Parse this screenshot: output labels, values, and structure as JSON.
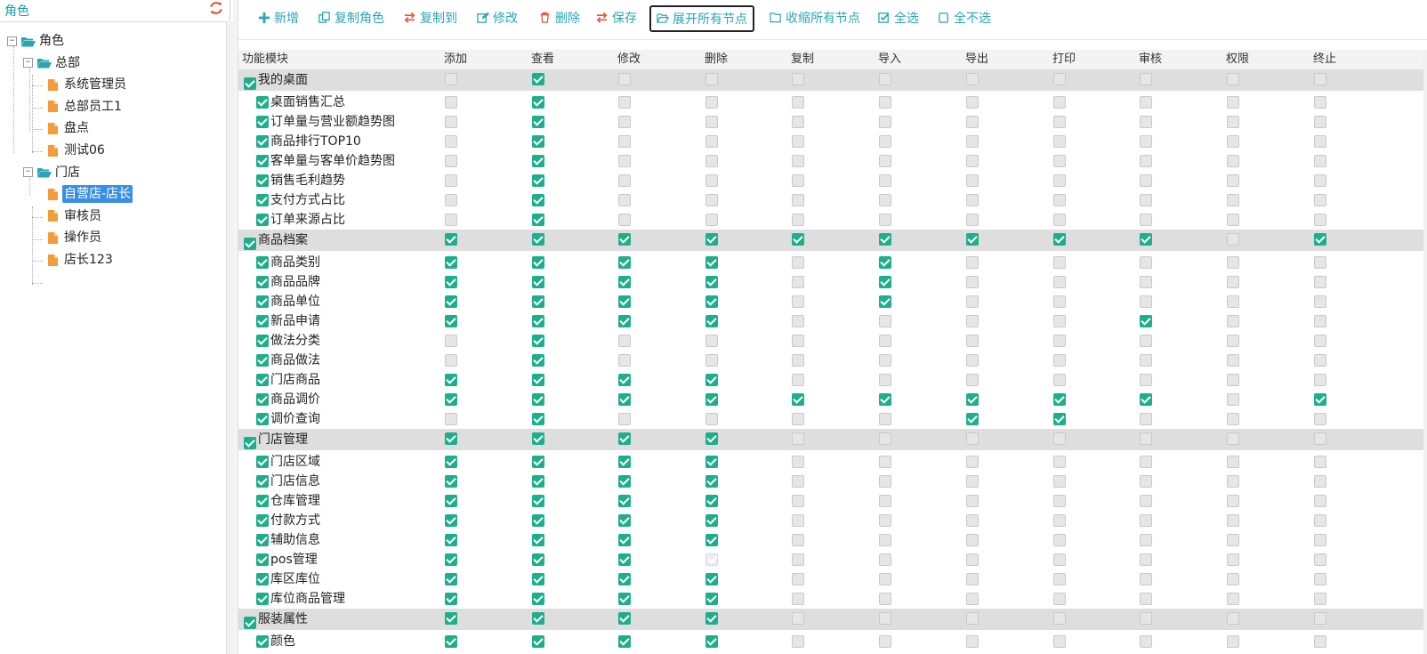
{
  "left_panel": {
    "title": "角色",
    "tree": [
      {
        "label": "角色",
        "type": "folder",
        "depth": 0,
        "toggle": "⊟"
      },
      {
        "label": "总部",
        "type": "folder",
        "depth": 1,
        "toggle": "⊟"
      },
      {
        "label": "系统管理员",
        "type": "file",
        "depth": 2
      },
      {
        "label": "总部员工1",
        "type": "file",
        "depth": 2
      },
      {
        "label": "盘点",
        "type": "file",
        "depth": 2
      },
      {
        "label": "测试06",
        "type": "file",
        "depth": 2
      },
      {
        "label": "门店",
        "type": "folder",
        "depth": 1,
        "toggle": "⊟"
      },
      {
        "label": "自营店-店长",
        "type": "file",
        "depth": 2,
        "selected": true
      },
      {
        "label": "审核员",
        "type": "file",
        "depth": 2
      },
      {
        "label": "操作员",
        "type": "file",
        "depth": 2
      },
      {
        "label": "店长123",
        "type": "file",
        "depth": 2
      }
    ]
  },
  "toolbar": {
    "buttons": [
      {
        "name": "add-button",
        "icon": "plus-icon",
        "label": "新增",
        "color": "#2aa5b5"
      },
      {
        "name": "copy-role-button",
        "icon": "copy-icon",
        "label": "复制角色",
        "color": "#2aa5b5"
      },
      {
        "name": "copy-to-button",
        "icon": "swap-icon",
        "label": "复制到",
        "color": "#e05a3a"
      },
      {
        "name": "edit-button",
        "icon": "edit-icon",
        "label": "修改",
        "color": "#2aa5b5"
      },
      {
        "name": "delete-button",
        "icon": "trash-icon",
        "label": "删除",
        "color": "#e05a3a"
      },
      {
        "name": "save-button",
        "icon": "swap-icon",
        "label": "保存",
        "color": "#e05a3a"
      },
      {
        "name": "expand-all-button",
        "icon": "folder-open-icon",
        "label": "展开所有节点",
        "color": "#2aa5b5",
        "active": true
      },
      {
        "name": "collapse-all-button",
        "icon": "folder-icon",
        "label": "收缩所有节点",
        "color": "#2aa5b5"
      },
      {
        "name": "select-all-button",
        "icon": "checked-box-icon",
        "label": "全选",
        "color": "#2aa5b5"
      },
      {
        "name": "select-none-button",
        "icon": "empty-box-icon",
        "label": "全不选",
        "color": "#2aa5b5"
      }
    ]
  },
  "grid": {
    "columns": [
      "功能模块",
      "添加",
      "查看",
      "修改",
      "删除",
      "复制",
      "导入",
      "导出",
      "打印",
      "审核",
      "权限",
      "终止"
    ],
    "rows": [
      {
        "label": "我的桌面",
        "group": true,
        "c": "01000000000"
      },
      {
        "label": "桌面销售汇总",
        "c": "01000000000"
      },
      {
        "label": "订单量与营业额趋势图",
        "c": "01000000000"
      },
      {
        "label": "商品排行TOP10",
        "c": "01000000000"
      },
      {
        "label": "客单量与客单价趋势图",
        "c": "01000000000"
      },
      {
        "label": "销售毛利趋势",
        "c": "01000000000"
      },
      {
        "label": "支付方式占比",
        "c": "01000000000"
      },
      {
        "label": "订单来源占比",
        "c": "01000000000"
      },
      {
        "label": "商品档案",
        "group": true,
        "c": "11111111101"
      },
      {
        "label": "商品类别",
        "c": "11110100000"
      },
      {
        "label": "商品品牌",
        "c": "11110100000"
      },
      {
        "label": "商品单位",
        "c": "11110100000"
      },
      {
        "label": "新品申请",
        "c": "11110000100"
      },
      {
        "label": "做法分类",
        "c": "01000000000"
      },
      {
        "label": "商品做法",
        "c": "01000000000"
      },
      {
        "label": "门店商品",
        "c": "11110000000"
      },
      {
        "label": "商品调价",
        "c": "11111111101"
      },
      {
        "label": "调价查询",
        "c": "01000011000"
      },
      {
        "label": "门店管理",
        "group": true,
        "c": "11110000000"
      },
      {
        "label": "门店区域",
        "c": "11110000000"
      },
      {
        "label": "门店信息",
        "c": "11110000000"
      },
      {
        "label": "仓库管理",
        "c": "11110000000"
      },
      {
        "label": "付款方式",
        "c": "11110000000"
      },
      {
        "label": "辅助信息",
        "c": "11110000000"
      },
      {
        "label": "pos管理",
        "c": "111d0000000"
      },
      {
        "label": "库区库位",
        "c": "11110000000"
      },
      {
        "label": "库位商品管理",
        "c": "11110000000"
      },
      {
        "label": "服装属性",
        "group": true,
        "c": "11110000000"
      },
      {
        "label": "颜色",
        "c": "11110000000"
      }
    ]
  },
  "colors": {
    "accent": "#2aa5b5",
    "check": "#1fae8b",
    "danger": "#e05a3a",
    "group_row": "#dedede"
  }
}
